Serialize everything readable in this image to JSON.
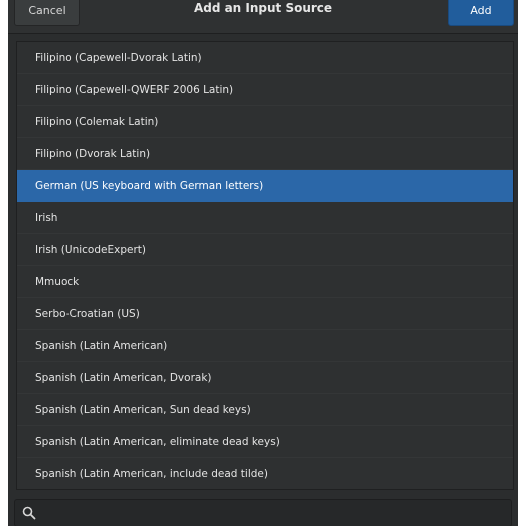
{
  "header": {
    "title": "Add an Input Source",
    "cancel_label": "Cancel",
    "add_label": "Add"
  },
  "list": {
    "items": [
      {
        "label": "Filipino (Capewell-Dvorak Latin)",
        "selected": false
      },
      {
        "label": "Filipino (Capewell-QWERF 2006 Latin)",
        "selected": false
      },
      {
        "label": "Filipino (Colemak Latin)",
        "selected": false
      },
      {
        "label": "Filipino (Dvorak Latin)",
        "selected": false
      },
      {
        "label": "German (US keyboard with German letters)",
        "selected": true
      },
      {
        "label": "Irish",
        "selected": false
      },
      {
        "label": "Irish (UnicodeExpert)",
        "selected": false
      },
      {
        "label": "Mmuock",
        "selected": false
      },
      {
        "label": "Serbo-Croatian (US)",
        "selected": false
      },
      {
        "label": "Spanish (Latin American)",
        "selected": false
      },
      {
        "label": "Spanish (Latin American, Dvorak)",
        "selected": false
      },
      {
        "label": "Spanish (Latin American, Sun dead keys)",
        "selected": false
      },
      {
        "label": "Spanish (Latin American, eliminate dead keys)",
        "selected": false
      },
      {
        "label": "Spanish (Latin American, include dead tilde)",
        "selected": false
      }
    ]
  },
  "search": {
    "value": "",
    "placeholder": "",
    "icon": "search-icon"
  },
  "colors": {
    "accent": "#2b67a8",
    "add_button": "#215d9c",
    "background": "#2b2d2e",
    "text": "#e4e4e4"
  }
}
